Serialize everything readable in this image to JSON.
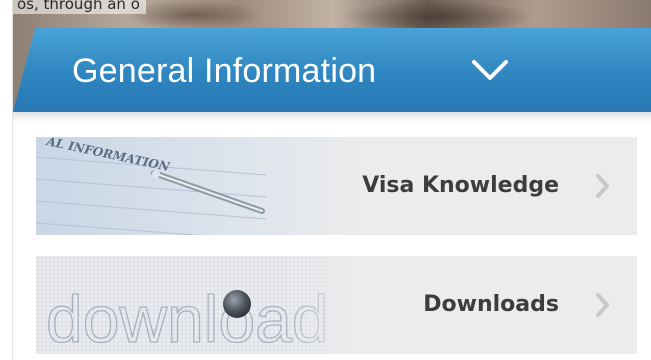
{
  "header": {
    "photo_caption": "os, through an o",
    "title": "General Information",
    "expand_icon": "chevron-down-icon"
  },
  "cards": [
    {
      "label": "Visa Knowledge",
      "image_text": "AL INFORMATION",
      "arrow_icon": "chevron-right-icon"
    },
    {
      "label": "Downloads",
      "image_text": "download",
      "arrow_icon": "chevron-right-icon"
    }
  ],
  "colors": {
    "banner_blue": "#2f86c0",
    "card_bg": "#ececec",
    "label_text": "#3d3d3d",
    "arrow_gray": "#c8c8c8"
  }
}
